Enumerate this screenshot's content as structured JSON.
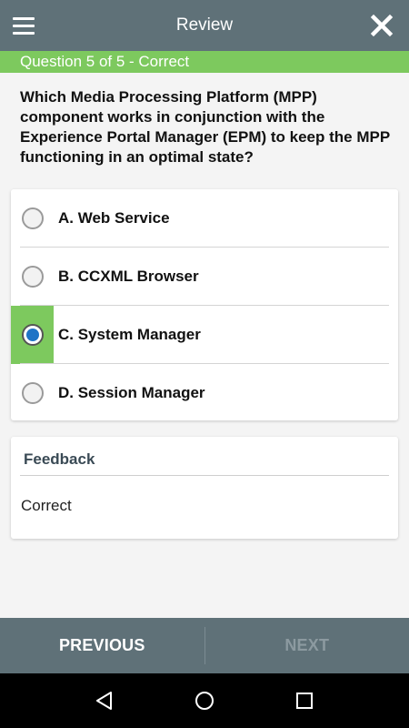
{
  "header": {
    "title": "Review",
    "menu_icon": "hamburger-menu-icon",
    "close_icon": "close-icon"
  },
  "status": {
    "text": "Question 5 of 5 - Correct",
    "color": "#7dc95e"
  },
  "question": {
    "text": "Which Media Processing Platform (MPP) component works in conjunction with the Experience Portal Manager (EPM) to keep the MPP functioning in an optimal state?"
  },
  "options": [
    {
      "label": "A. Web Service",
      "selected": false
    },
    {
      "label": "B. CCXML Browser",
      "selected": false
    },
    {
      "label": "C. System Manager",
      "selected": true
    },
    {
      "label": "D. Session Manager",
      "selected": false
    }
  ],
  "feedback": {
    "title": "Feedback",
    "text": "Correct"
  },
  "navigation": {
    "previous_label": "PREVIOUS",
    "next_label": "NEXT"
  },
  "system_bar": {
    "back_icon": "back-triangle-icon",
    "home_icon": "home-circle-icon",
    "recents_icon": "recents-square-icon"
  },
  "colors": {
    "header": "#5f7178",
    "accent_green": "#7dc95e",
    "radio_selected": "#1f74c6"
  }
}
